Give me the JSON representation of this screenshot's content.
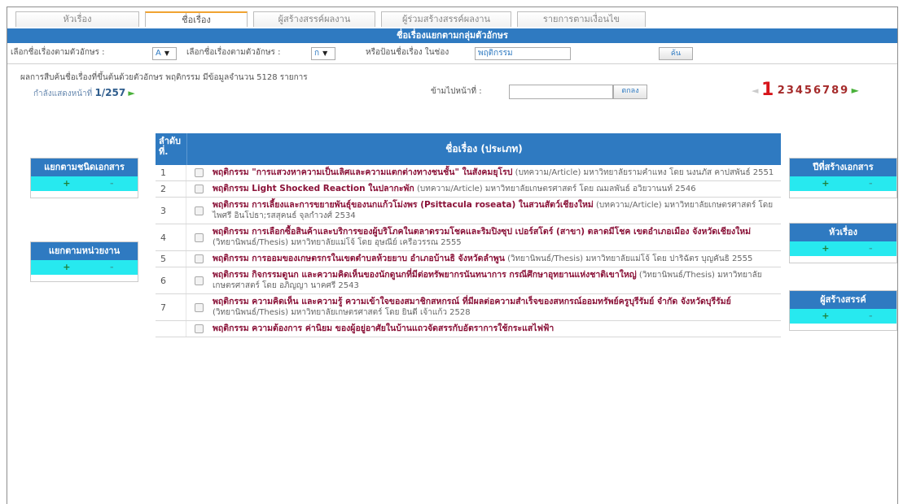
{
  "tabs": [
    "หัวเรื่อง",
    "ชื่อเรื่อง",
    "ผู้สร้างสรรค์ผลงาน",
    "ผู้ร่วมสร้างสรรค์ผลงาน",
    "รายการตามเงื่อนไข"
  ],
  "title": "ชื่อเรื่องแยกตามกลุ่มตัวอักษร",
  "filter": {
    "label1": "เลือกชื่อเรื่องตามตัวอักษร :",
    "select1": "A",
    "label2": "เลือกชื่อเรื่องตามตัวอักษร :",
    "select2": "ก",
    "label3": "หรือป้อนชื่อเรื่อง ในช่อง",
    "query": "พฤติกรรม",
    "search_btn": "ค้น"
  },
  "summary": "ผลการสืบค้นชื่อเรื่องที่ขึ้นต้นด้วยตัวอักษร พฤติกรรม มีข้อมูลจำนวน 5128 รายการ",
  "page_info": {
    "label": "กำลังแสดงหน้าที่",
    "value": "1/257"
  },
  "jump": {
    "label": "ข้ามไปหน้าที่ :",
    "button": "ตกลง"
  },
  "pager": {
    "current": "1",
    "pages": [
      "2",
      "3",
      "4",
      "5",
      "6",
      "7",
      "8",
      "9"
    ]
  },
  "left_panels": [
    {
      "title": "แยกตามชนิดเอกสาร",
      "plus": "+",
      "minus": "-"
    },
    {
      "title": "แยกตามหน่วยงาน",
      "plus": "+",
      "minus": "-"
    }
  ],
  "right_panels": [
    {
      "title": "ปีที่สร้างเอกสาร",
      "plus": "+",
      "minus": "-"
    },
    {
      "title": "หัวเรื่อง",
      "plus": "+",
      "minus": "-"
    },
    {
      "title": "ผู้สร้างสรรค์",
      "plus": "+",
      "minus": "-"
    }
  ],
  "table": {
    "col_num": "ลำดับที่.",
    "col_title": "ชื่อเรื่อง (ประเภท)",
    "rows": [
      {
        "num": "1",
        "title": "พฤติกรรม \"การแสวงหาความเป็นเลิศและความแตกต่างทางชนชั้น\" ในสังคมยุโรป",
        "detail": " (บทความ/Article) มหาวิทยาลัยรามคำแหง โดย นงนภัส คาปสพันธ์ 2551"
      },
      {
        "num": "2",
        "title": "พฤติกรรม Light Shocked Reaction ในปลากะพัก",
        "detail": " (บทความ/Article) มหาวิทยาลัยเกษตรศาสตร์ โดย ณมลพันธ์ อวิยวานนท์ 2546"
      },
      {
        "num": "3",
        "title": "พฤติกรรม การเลี้ยงและการขยายพันธุ์ของนกแก้วโม่งพร (Psittacula roseata) ในสวนสัตว์เชียงใหม่",
        "detail": " (บทความ/Article) มหาวิทยาลัยเกษตรศาสตร์ โดย ไพศรี อินโปธา;รสสุคนธ์ จุลกำวงศ์ 2534"
      },
      {
        "num": "4",
        "title": "พฤติกรรม การเลือกซื้อสินค้าและบริการของผู้บริโภคในตลาดรวมโชคและริมปิงซุป เปอร์สโตร์ (สาขา) ตลาดมีโชค เขตอำเภอเมือง จังหวัดเชียงใหม่",
        "detail": " (วิทยานิพนธ์/Thesis) มหาวิทยาลัยแม่โจ้ โดย อุษณีย์ เครือวรรณ 2555"
      },
      {
        "num": "5",
        "title": "พฤติกรรม การออมของเกษตรกรในเขตตำบลห้วยยาบ อำเภอบ้านธิ จังหวัดลำพูน",
        "detail": " (วิทยานิพนธ์/Thesis) มหาวิทยาลัยแม่โจ้ โดย ปาริฉัตร บุญคันธิ 2555"
      },
      {
        "num": "6",
        "title": "พฤติกรรม กิจกรรมดูนก และความคิดเห็นของนักดูนกที่มีต่อทรัพยากรนันทนาการ กรณีศึกษาอุทยานแห่งชาติเขาใหญ่",
        "detail": " (วิทยานิพนธ์/Thesis) มหาวิทยาลัยเกษตรศาสตร์ โดย อภิญญา นาคศรี 2543"
      },
      {
        "num": "7",
        "title": "พฤติกรรม ความคิดเห็น และความรู้ ความเข้าใจของสมาชิกสหกรณ์ ที่มีผลต่อความสำเร็จของสหกรณ์ออมทรัพย์ครูบุรีรัมย์ จำกัด จังหวัดบุรีรัมย์",
        "detail": " (วิทยานิพนธ์/Thesis) มหาวิทยาลัยเกษตรศาสตร์ โดย ยินดี เจ้าแก้ว 2528"
      },
      {
        "num": "",
        "title": "พฤติกรรม ความต้องการ ค่านิยม ของผู้อยู่อาศัยในบ้านแถวจัดสรรกับอัตราการใช้กระแสไฟฟ้า",
        "detail": ""
      }
    ]
  }
}
